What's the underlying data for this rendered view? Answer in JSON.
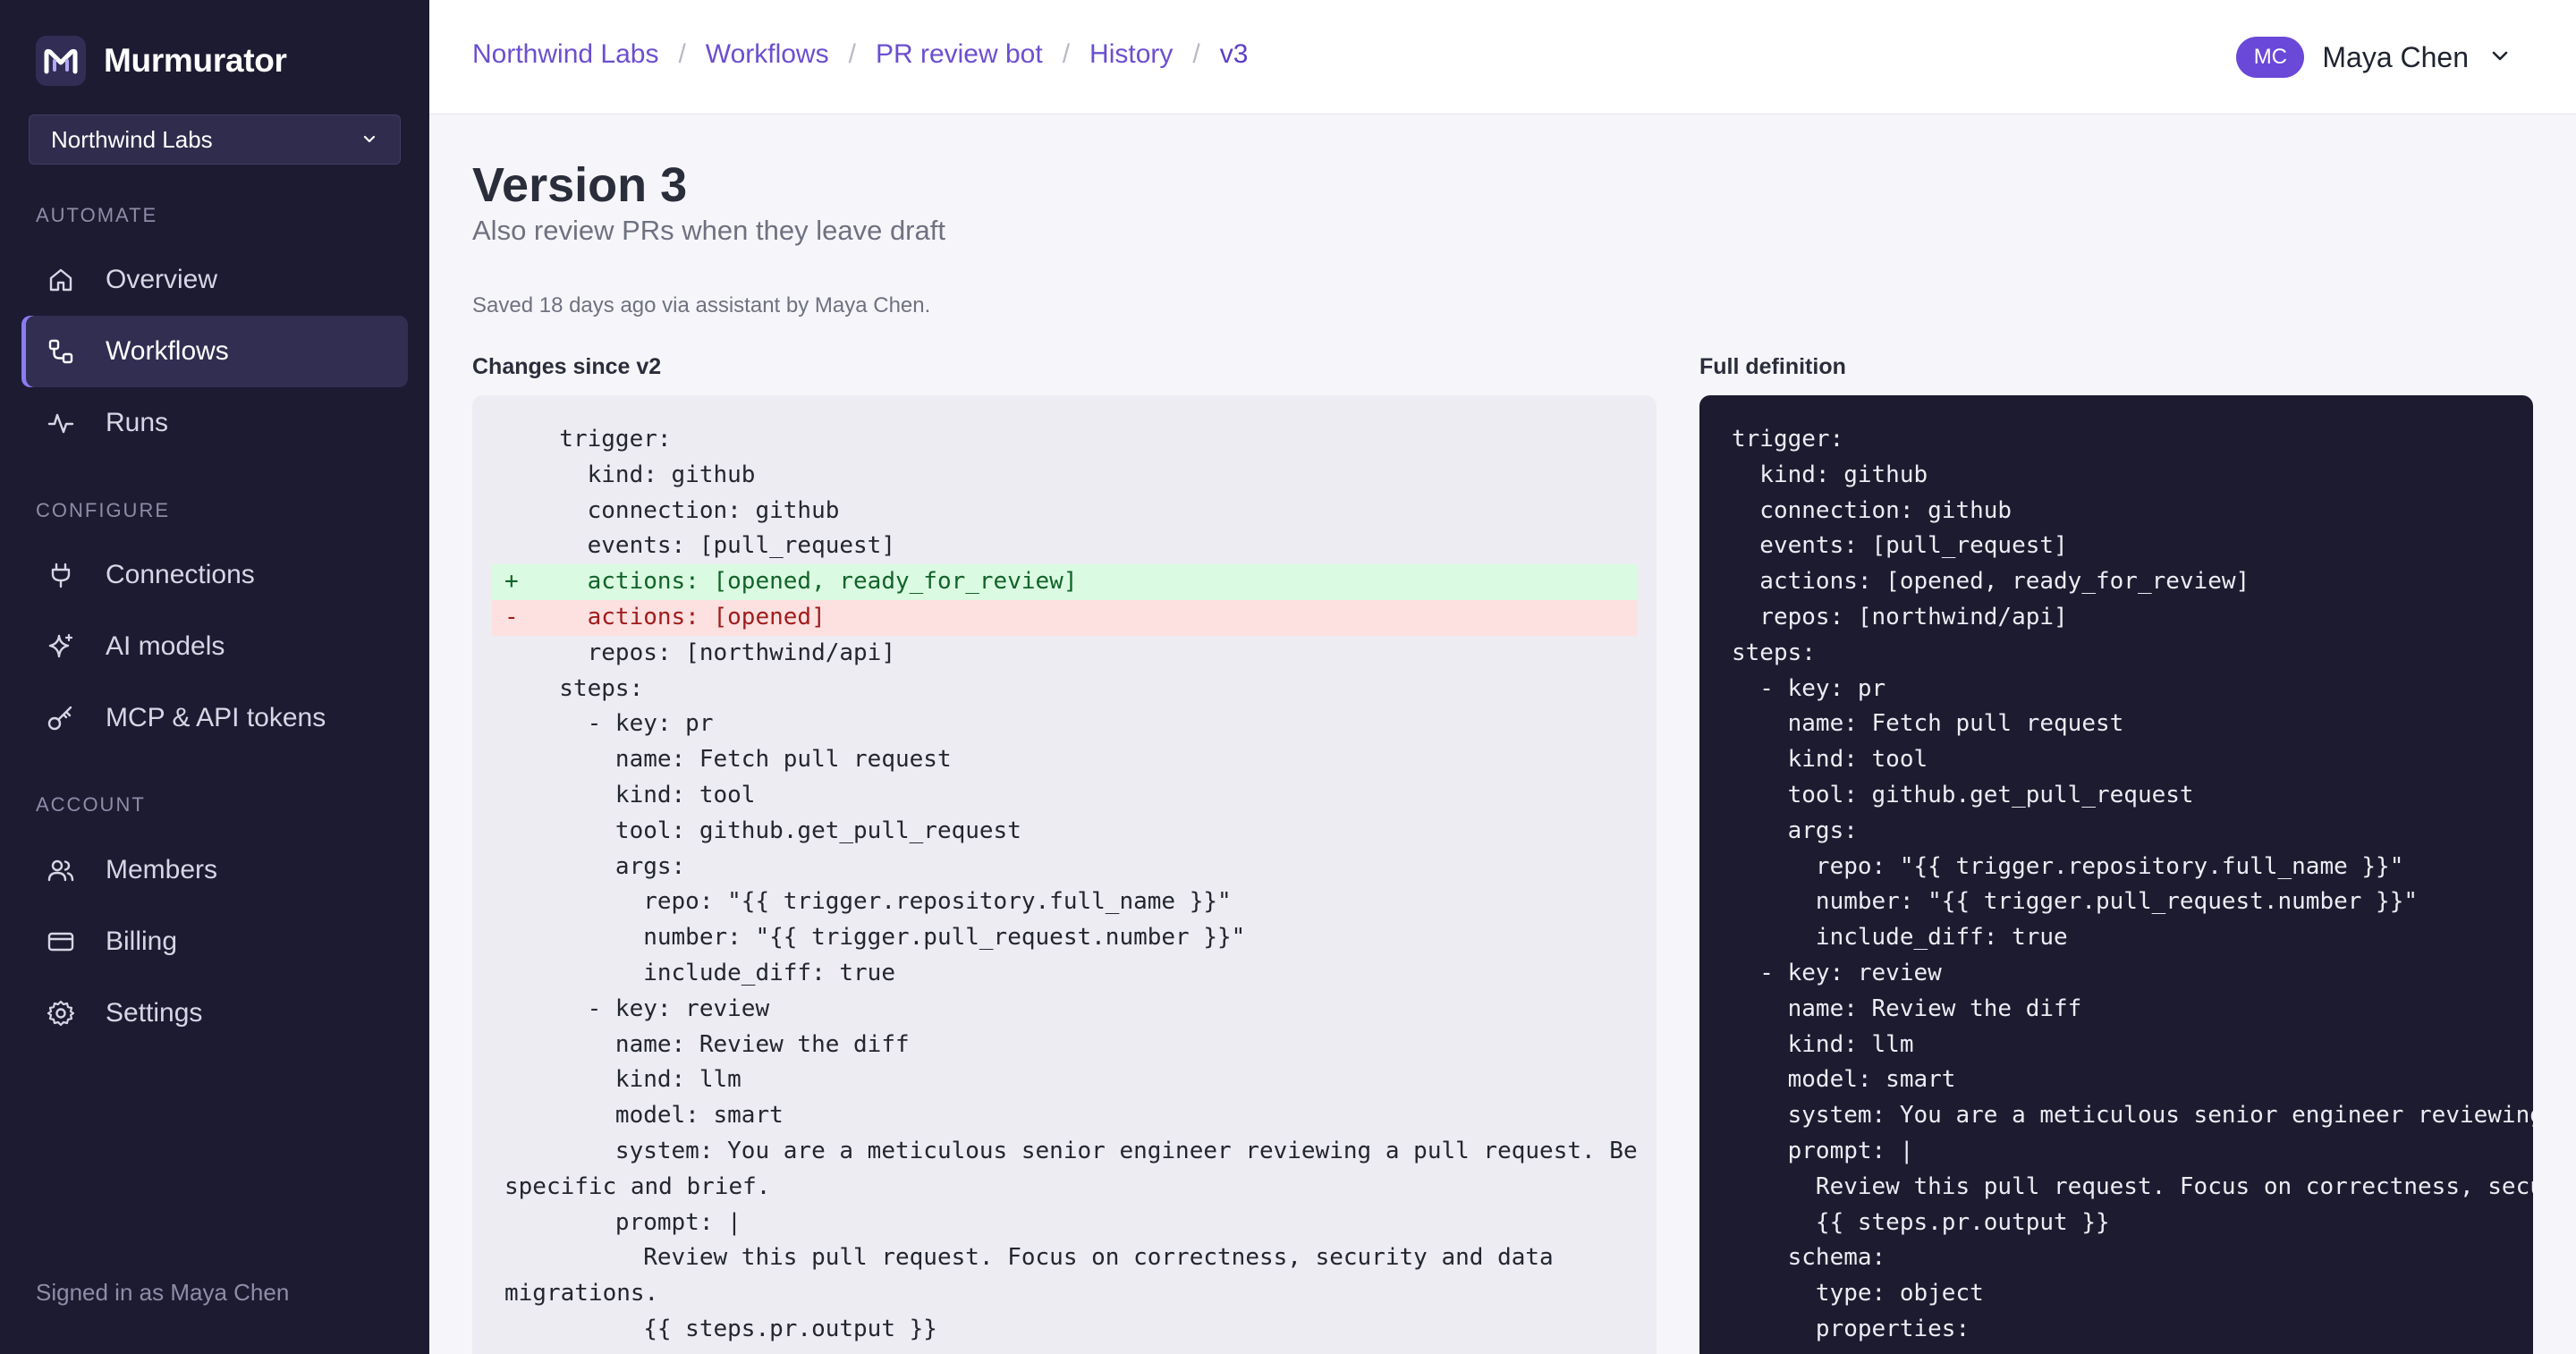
{
  "app": {
    "name": "Murmurator"
  },
  "org_selector": {
    "value": "Northwind Labs"
  },
  "sidebar": {
    "sections": [
      {
        "label": "AUTOMATE",
        "items": [
          "Overview",
          "Workflows",
          "Runs"
        ]
      },
      {
        "label": "CONFIGURE",
        "items": [
          "Connections",
          "AI models",
          "MCP & API tokens"
        ]
      },
      {
        "label": "ACCOUNT",
        "items": [
          "Members",
          "Billing",
          "Settings"
        ]
      }
    ],
    "active_item": "Workflows",
    "signed_in_text": "Signed in as Maya Chen"
  },
  "breadcrumb": [
    "Northwind Labs",
    "Workflows",
    "PR review bot",
    "History",
    "v3"
  ],
  "user": {
    "initials": "MC",
    "name": "Maya Chen"
  },
  "page": {
    "title": "Version 3",
    "subtitle": "Also review PRs when they leave draft",
    "saved_meta": "Saved 18 days ago via assistant by Maya Chen."
  },
  "diff": {
    "label": "Changes since v2",
    "lines": [
      {
        "type": "ctx",
        "text": "trigger:"
      },
      {
        "type": "ctx",
        "text": "  kind: github"
      },
      {
        "type": "ctx",
        "text": "  connection: github"
      },
      {
        "type": "ctx",
        "text": "  events: [pull_request]"
      },
      {
        "type": "add",
        "text": "  actions: [opened, ready_for_review]"
      },
      {
        "type": "del",
        "text": "  actions: [opened]"
      },
      {
        "type": "ctx",
        "text": "  repos: [northwind/api]"
      },
      {
        "type": "ctx",
        "text": "steps:"
      },
      {
        "type": "ctx",
        "text": "  - key: pr"
      },
      {
        "type": "ctx",
        "text": "    name: Fetch pull request"
      },
      {
        "type": "ctx",
        "text": "    kind: tool"
      },
      {
        "type": "ctx",
        "text": "    tool: github.get_pull_request"
      },
      {
        "type": "ctx",
        "text": "    args:"
      },
      {
        "type": "ctx",
        "text": "      repo: \"{{ trigger.repository.full_name }}\""
      },
      {
        "type": "ctx",
        "text": "      number: \"{{ trigger.pull_request.number }}\""
      },
      {
        "type": "ctx",
        "text": "      include_diff: true"
      },
      {
        "type": "ctx",
        "text": "  - key: review"
      },
      {
        "type": "ctx",
        "text": "    name: Review the diff"
      },
      {
        "type": "ctx",
        "text": "    kind: llm"
      },
      {
        "type": "ctx",
        "text": "    model: smart"
      },
      {
        "type": "ctx",
        "text": "    system: You are a meticulous senior engineer reviewing a pull request. Be"
      },
      {
        "type": "wrap",
        "text": "specific and brief."
      },
      {
        "type": "ctx",
        "text": "    prompt: |"
      },
      {
        "type": "ctx",
        "text": "      Review this pull request. Focus on correctness, security and data"
      },
      {
        "type": "wrap",
        "text": "migrations."
      },
      {
        "type": "ctx",
        "text": "      {{ steps.pr.output }}"
      }
    ]
  },
  "definition": {
    "label": "Full definition",
    "lines": [
      "trigger:",
      "  kind: github",
      "  connection: github",
      "  events: [pull_request]",
      "  actions: [opened, ready_for_review]",
      "  repos: [northwind/api]",
      "steps:",
      "  - key: pr",
      "    name: Fetch pull request",
      "    kind: tool",
      "    tool: github.get_pull_request",
      "    args:",
      "      repo: \"{{ trigger.repository.full_name }}\"",
      "      number: \"{{ trigger.pull_request.number }}\"",
      "      include_diff: true",
      "  - key: review",
      "    name: Review the diff",
      "    kind: llm",
      "    model: smart",
      "    system: You are a meticulous senior engineer reviewing",
      "    prompt: |",
      "      Review this pull request. Focus on correctness, secur",
      "      {{ steps.pr.output }}",
      "    schema:",
      "      type: object",
      "      properties:"
    ]
  },
  "colors": {
    "sidebar_bg": "#1d1b32",
    "accent": "#6b4fd0",
    "diff_add_bg": "#dafbe1",
    "diff_del_bg": "#fde0e0",
    "definition_bg": "#1d1b2f"
  }
}
